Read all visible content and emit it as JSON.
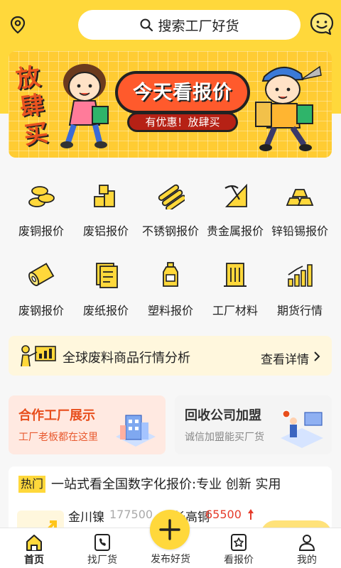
{
  "header": {
    "search_placeholder": "搜索工厂好货"
  },
  "banner": {
    "side_text": "放肆买",
    "title": "今天看报价",
    "subtitle": "有优惠！放肆买"
  },
  "categories": [
    {
      "label": "废铜报价",
      "icon": "copper-coins-icon"
    },
    {
      "label": "废铝报价",
      "icon": "aluminum-blocks-icon"
    },
    {
      "label": "不锈钢报价",
      "icon": "steel-rolls-icon"
    },
    {
      "label": "贵金属报价",
      "icon": "mining-pick-icon"
    },
    {
      "label": "锌铅锡报价",
      "icon": "ingot-bars-icon"
    },
    {
      "label": "废钢报价",
      "icon": "steel-coil-icon"
    },
    {
      "label": "废纸报价",
      "icon": "paper-doc-icon"
    },
    {
      "label": "塑料报价",
      "icon": "plastic-bottle-icon"
    },
    {
      "label": "工厂材料",
      "icon": "factory-building-icon"
    },
    {
      "label": "期货行情",
      "icon": "bar-chart-icon"
    }
  ],
  "analysis": {
    "title": "全球废料商品行情分析",
    "more": "查看详情"
  },
  "cards": [
    {
      "title": "合作工厂展示",
      "subtitle": "工厂老板都在这里"
    },
    {
      "title": "回收公司加盟",
      "subtitle": "诚信加盟能买厂货"
    }
  ],
  "news": {
    "tag": "热门",
    "headline": "一站式看全国数字化报价:专业 创新 实用",
    "price1_name": "金川镍",
    "price1_value": "177500",
    "price2_name": "长高铜",
    "price2_value": "65500"
  },
  "tabs": [
    {
      "label": "首页",
      "icon": "home-icon"
    },
    {
      "label": "找厂货",
      "icon": "phone-book-icon"
    },
    {
      "label": "发布好货",
      "icon": "plus-icon"
    },
    {
      "label": "看报价",
      "icon": "star-quote-icon"
    },
    {
      "label": "我的",
      "icon": "user-icon"
    }
  ],
  "colors": {
    "brand_yellow": "#ffd83b",
    "accent_orange": "#e84e1c",
    "price_up_red": "#e53b2a"
  }
}
